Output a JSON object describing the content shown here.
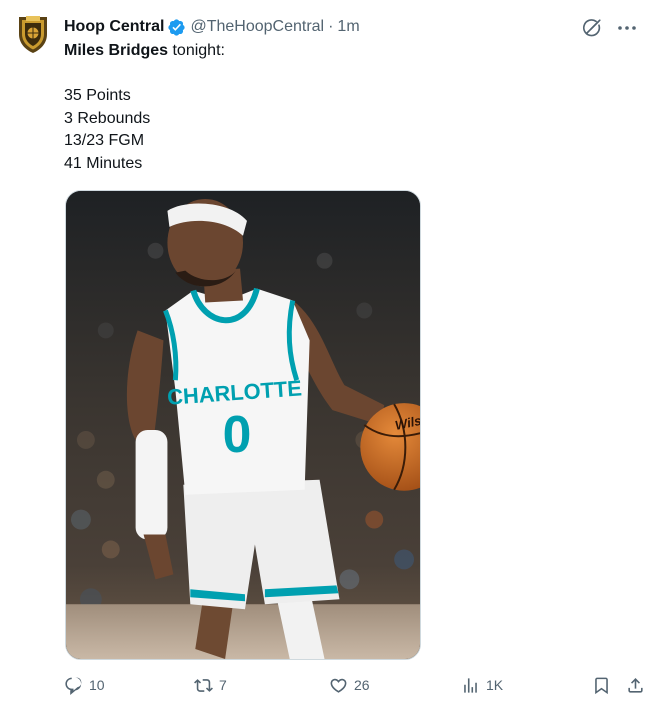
{
  "author": {
    "display_name": "Hoop Central",
    "handle": "@TheHoopCentral",
    "separator": "·",
    "time": "1m",
    "verified_color": "#1d9bf0"
  },
  "tweet": {
    "bold_name": "Miles Bridges",
    "after_name": " tonight:",
    "stats": [
      "35 Points",
      "3 Rebounds",
      "13/23 FGM",
      "41 Minutes"
    ]
  },
  "media": {
    "jersey_text": "CHARLOTTE",
    "jersey_number": "0",
    "accent_color": "#00a0b0"
  },
  "engagement": {
    "replies": "10",
    "reposts": "7",
    "likes": "26",
    "views": "1K"
  },
  "icons": {
    "reply": "reply-icon",
    "repost": "repost-icon",
    "like": "heart-icon",
    "views": "views-icon",
    "bookmark": "bookmark-icon",
    "share": "share-icon",
    "grok": "grok-icon",
    "more": "more-icon"
  }
}
